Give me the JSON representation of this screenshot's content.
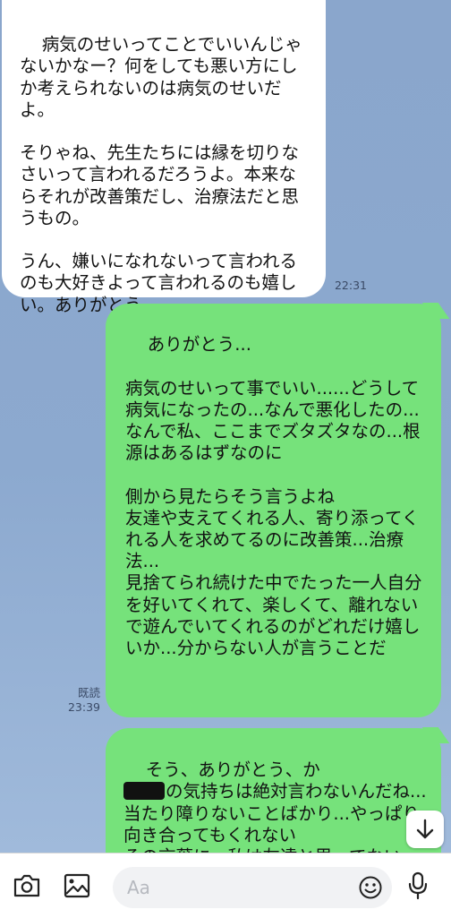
{
  "messages": [
    {
      "direction": "incoming",
      "text": "病気のせいってことでいいんじゃないかなー？何をしても悪い方にしか考えられないのは病気のせいだよ。\n\nそりゃね、先生たちには縁を切りなさいって言われるだろうよ。本来ならそれが改善策だし、治療法だと思うもの。\n\nうん、嫌いになれないって言われるのも大好きよって言われるのも嬉しい。ありがとう。",
      "time": "22:31"
    },
    {
      "direction": "outgoing",
      "text": "ありがとう...\n\n病気のせいって事でいい......どうして病気になったの...なんで悪化したの...\nなんで私、ここまでズタズタなの...根源はあるはずなのに\n\n側から見たらそう言うよね\n友達や支えてくれる人、寄り添ってくれる人を求めてるのに改善策...治療法...\n見捨てられ続けた中でたった一人自分を好いてくれて、楽しくて、離れないで遊んでいてくれるのがどれだけ嬉しいか...分からない人が言うことだ",
      "read_label": "既読",
      "time": "23:39"
    },
    {
      "direction": "outgoing",
      "line1": "そう、ありがとう、か",
      "line2_after_redaction": "の気持ちは絶対言わないんだね...当たり障りないことばかり...やっぱり向き合ってもくれない\nその言葉に、私は友達と思ってない"
    }
  ],
  "input_bar": {
    "placeholder": "Aa",
    "icons": [
      "camera-icon",
      "image-icon",
      "emoji-icon",
      "microphone-icon"
    ]
  },
  "scroll_button_icon": "arrow-down-icon"
}
